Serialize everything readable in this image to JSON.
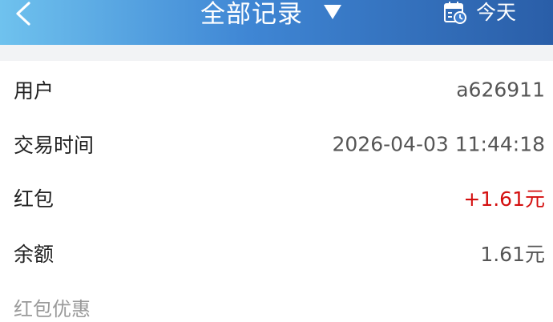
{
  "header": {
    "title": "全部记录",
    "today_label": "今天",
    "back_icon": "chevron-left-icon",
    "dropdown_icon": "caret-down-icon",
    "calendar_icon": "calendar-clock-icon",
    "gradient_colors": [
      "#6fc2ee",
      "#3f86d4",
      "#2a5ea8"
    ]
  },
  "details": {
    "user": {
      "label": "用户",
      "value": "a626911"
    },
    "time": {
      "label": "交易时间",
      "value": "2026-04-03 11:44:18"
    },
    "hongbao": {
      "label": "红包",
      "value": "+1.61元",
      "color": "#d40f0f"
    },
    "balance": {
      "label": "余额",
      "value": "1.61元"
    }
  },
  "section": {
    "label": "红包优惠"
  }
}
